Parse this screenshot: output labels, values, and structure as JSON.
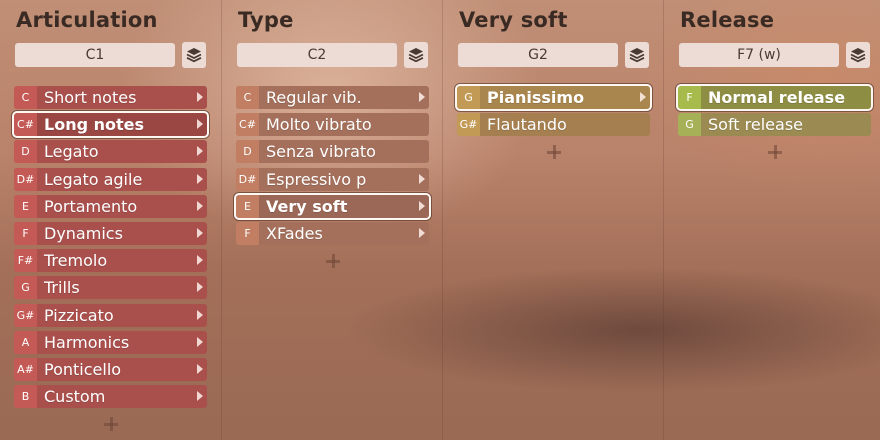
{
  "columns": [
    {
      "title": "Articulation",
      "key": "C1",
      "items": [
        {
          "note": "C",
          "label": "Short notes"
        },
        {
          "note": "C#",
          "label": "Long notes",
          "selected": true
        },
        {
          "note": "D",
          "label": "Legato"
        },
        {
          "note": "D#",
          "label": "Legato agile"
        },
        {
          "note": "E",
          "label": "Portamento"
        },
        {
          "note": "F",
          "label": "Dynamics"
        },
        {
          "note": "F#",
          "label": "Tremolo"
        },
        {
          "note": "G",
          "label": "Trills"
        },
        {
          "note": "G#",
          "label": "Pizzicato"
        },
        {
          "note": "A",
          "label": "Harmonics"
        },
        {
          "note": "A#",
          "label": "Ponticello"
        },
        {
          "note": "B",
          "label": "Custom"
        }
      ]
    },
    {
      "title": "Type",
      "key": "C2",
      "items": [
        {
          "note": "C",
          "label": "Regular vib."
        },
        {
          "note": "C#",
          "label": "Molto vibrato"
        },
        {
          "note": "D",
          "label": "Senza vibrato"
        },
        {
          "note": "D#",
          "label": "Espressivo p"
        },
        {
          "note": "E",
          "label": "Very soft",
          "selected": true
        },
        {
          "note": "F",
          "label": "XFades"
        }
      ]
    },
    {
      "title": "Very soft",
      "key": "G2",
      "items": [
        {
          "note": "G",
          "label": "Pianissimo",
          "selected": true
        },
        {
          "note": "G#",
          "label": "Flautando"
        }
      ]
    },
    {
      "title": "Release",
      "key": "F7 (w)",
      "items": [
        {
          "note": "F",
          "label": "Normal release",
          "selected": true
        },
        {
          "note": "G",
          "label": "Soft release"
        }
      ]
    }
  ],
  "icons": {
    "layers": "layers-icon",
    "add": "plus-icon",
    "submenu": "chevron-right-icon"
  },
  "colors": {
    "articulation": "#a9504d",
    "type": "#a4705c",
    "very_soft": "#a57f50",
    "release": "#9b8b52"
  }
}
